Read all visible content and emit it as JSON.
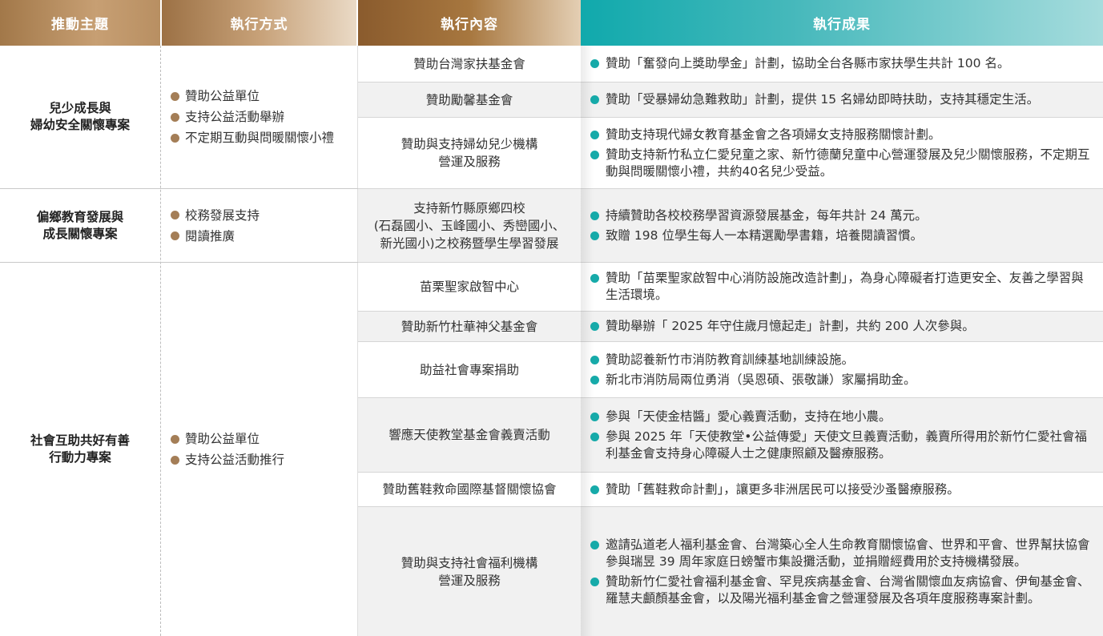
{
  "header": {
    "theme": "推動主題",
    "method": "執行方式",
    "content": "執行內容",
    "result": "執行成果"
  },
  "colors": {
    "bullet_brown": "#a47e57",
    "bullet_teal": "#16aaa9",
    "header_teal": "#10a9ac",
    "header_brown": "#a27849"
  },
  "groups": [
    {
      "theme": [
        "兒少成長與",
        "婦幼安全關懷專案"
      ],
      "methods": [
        "贊助公益單位",
        "支持公益活動舉辦",
        "不定期互動與問暖關懷小禮"
      ],
      "rows": [
        {
          "content": [
            "贊助台灣家扶基金會"
          ],
          "results": [
            "贊助「奮發向上獎助學金」計劃，協助全台各縣市家扶學生共計 100 名。"
          ]
        },
        {
          "content": [
            "贊助勵馨基金會"
          ],
          "results": [
            "贊助「受暴婦幼急難救助」計劃，提供 15 名婦幼即時扶助，支持其穩定生活。"
          ]
        },
        {
          "content": [
            "贊助與支持婦幼兒少機構",
            "營運及服務"
          ],
          "results": [
            "贊助支持現代婦女教育基金會之各項婦女支持服務關懷計劃。",
            "贊助支持新竹私立仁愛兒童之家、新竹德蘭兒童中心營運發展及兒少關懷服務，不定期互動與問暖關懷小禮，共約40名兒少受益。"
          ]
        }
      ]
    },
    {
      "theme": [
        "偏鄉教育發展與",
        "成長關懷專案"
      ],
      "methods": [
        "校務發展支持",
        "閱讀推廣"
      ],
      "rows": [
        {
          "content": [
            "支持新竹縣原鄉四校",
            "(石磊國小、玉峰國小、秀巒國小、",
            "新光國小)之校務暨學生學習發展"
          ],
          "results": [
            "持續贊助各校校務學習資源發展基金，每年共計 24 萬元。",
            "致贈 198 位學生每人一本精選勵學書籍，培養閱讀習慣。"
          ]
        }
      ]
    },
    {
      "theme": [
        "社會互助共好有善",
        "行動力專案"
      ],
      "methods": [
        "贊助公益單位",
        "支持公益活動推行"
      ],
      "rows": [
        {
          "content": [
            "苗栗聖家啟智中心"
          ],
          "results": [
            "贊助「苗栗聖家啟智中心消防設施改造計劃」，為身心障礙者打造更安全、友善之學習與生活環境。"
          ]
        },
        {
          "content": [
            "贊助新竹杜華神父基金會"
          ],
          "results": [
            "贊助舉辦「 2025 年守住歲月憶起走」計劃，共約 200 人次參與。"
          ]
        },
        {
          "content": [
            "助益社會專案捐助"
          ],
          "results": [
            "贊助認養新竹市消防教育訓練基地訓練設施。",
            "新北市消防局兩位勇消（吳恩碩、張敬謙）家屬捐助金。"
          ]
        },
        {
          "content": [
            "響應天使教堂基金會義賣活動"
          ],
          "results": [
            "參與「天使金桔醬」愛心義賣活動，支持在地小農。",
            "參與 2025 年「天使教堂•公益傳愛」天使文旦義賣活動，義賣所得用於新竹仁愛社會福利基金會支持身心障礙人士之健康照顧及醫療服務。"
          ]
        },
        {
          "content": [
            "贊助舊鞋救命國際基督關懷協會"
          ],
          "results": [
            "贊助「舊鞋救命計劃」，讓更多非洲居民可以接受沙蚤醫療服務。"
          ]
        },
        {
          "content": [
            "贊助與支持社會福利機構",
            "營運及服務"
          ],
          "results": [
            "邀請弘道老人福利基金會、台灣築心全人生命教育關懷協會、世界和平會、世界幫扶協會參與瑞昱 39 周年家庭日螃蟹市集設攤活動，並捐贈經費用於支持機構發展。",
            "贊助新竹仁愛社會福利基金會、罕見疾病基金會、台灣省關懷血友病協會、伊甸基金會、羅慧夫顱顏基金會，以及陽光福利基金會之營運發展及各項年度服務專案計劃。"
          ]
        }
      ]
    }
  ]
}
